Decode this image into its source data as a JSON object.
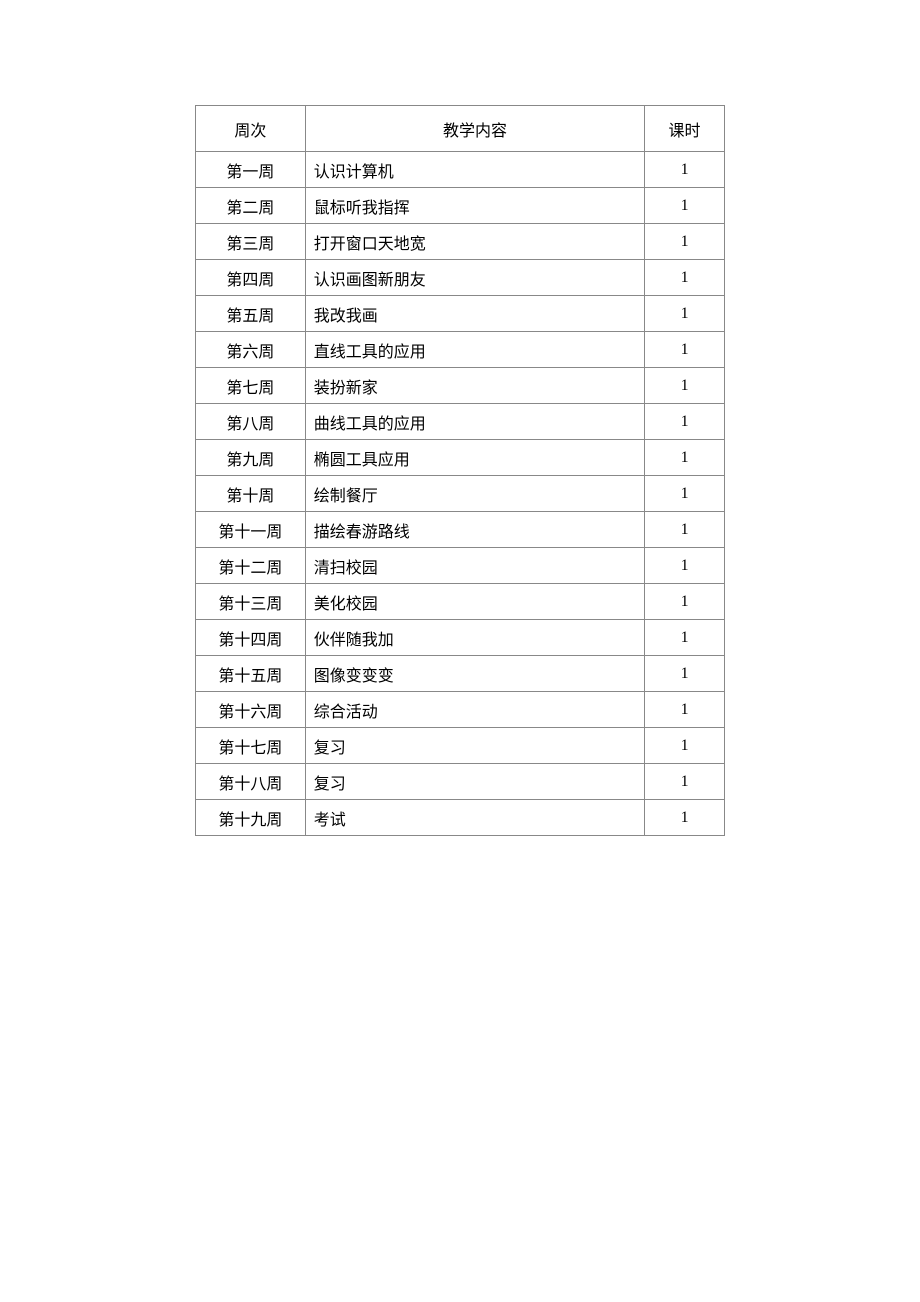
{
  "headers": {
    "week": "周次",
    "content": "教学内容",
    "hours": "课时"
  },
  "rows": [
    {
      "week": "第一周",
      "content": "认识计算机",
      "hours": "1"
    },
    {
      "week": "第二周",
      "content": "鼠标听我指挥",
      "hours": "1"
    },
    {
      "week": "第三周",
      "content": "打开窗口天地宽",
      "hours": "1"
    },
    {
      "week": "第四周",
      "content": "认识画图新朋友",
      "hours": "1"
    },
    {
      "week": "第五周",
      "content": "我改我画",
      "hours": "1"
    },
    {
      "week": "第六周",
      "content": "直线工具的应用",
      "hours": "1"
    },
    {
      "week": "第七周",
      "content": "装扮新家",
      "hours": "1"
    },
    {
      "week": "第八周",
      "content": "曲线工具的应用",
      "hours": "1"
    },
    {
      "week": "第九周",
      "content": "椭圆工具应用",
      "hours": "1"
    },
    {
      "week": "第十周",
      "content": "绘制餐厅",
      "hours": "1"
    },
    {
      "week": "第十一周",
      "content": "描绘春游路线",
      "hours": "1"
    },
    {
      "week": "第十二周",
      "content": "清扫校园",
      "hours": "1"
    },
    {
      "week": "第十三周",
      "content": "美化校园",
      "hours": "1"
    },
    {
      "week": "第十四周",
      "content": "伙伴随我加",
      "hours": "1"
    },
    {
      "week": "第十五周",
      "content": "图像变变变",
      "hours": "1"
    },
    {
      "week": "第十六周",
      "content": "综合活动",
      "hours": "1"
    },
    {
      "week": "第十七周",
      "content": "复习",
      "hours": "1"
    },
    {
      "week": "第十八周",
      "content": "复习",
      "hours": "1"
    },
    {
      "week": "第十九周",
      "content": "考试",
      "hours": "1"
    }
  ]
}
